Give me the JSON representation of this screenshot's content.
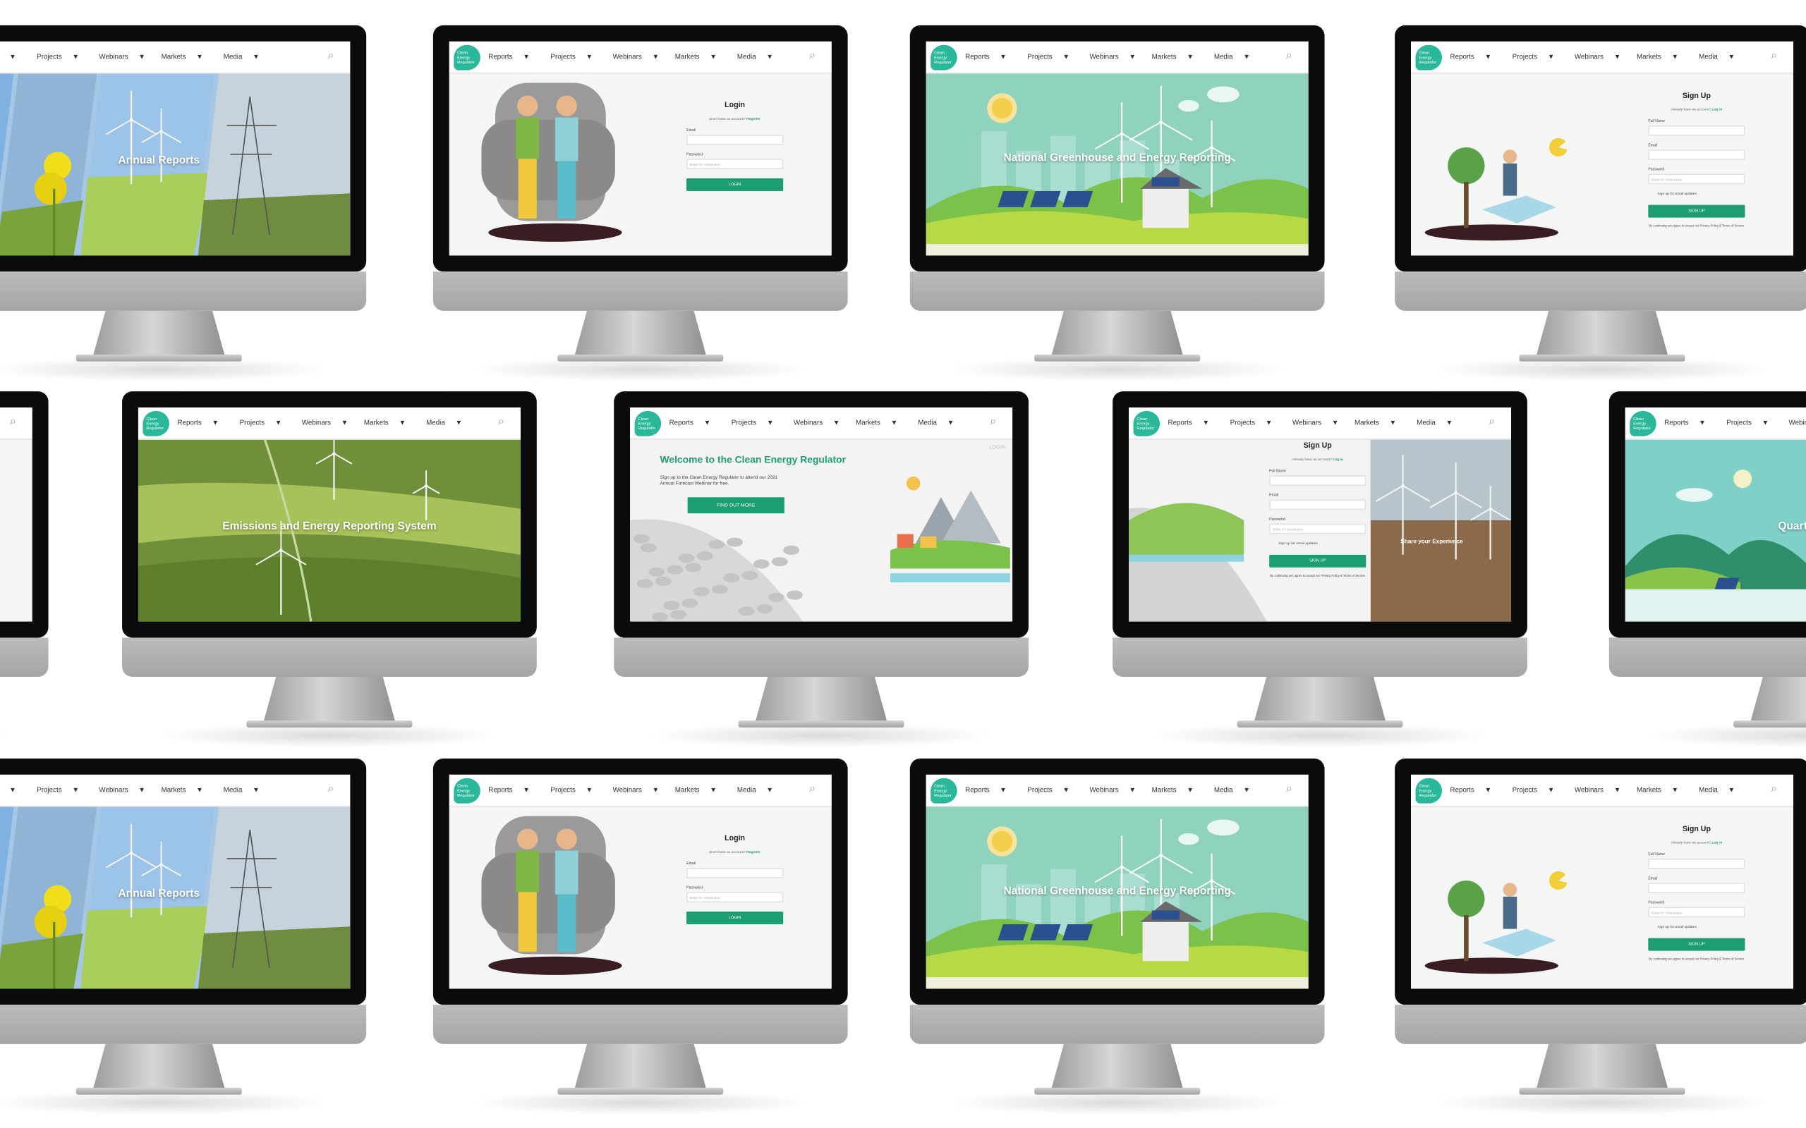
{
  "nav": {
    "logo_text": "Clean Energy Regulator",
    "items": [
      "Reports",
      "Projects",
      "Webinars",
      "Markets",
      "Media"
    ],
    "caret": "▼",
    "search_icon": "search-icon"
  },
  "apple_glyph": "",
  "screens": {
    "annual": {
      "title": "Annual Reports"
    },
    "greenhouse": {
      "title": "National Greenhouse and Energy Reporting"
    },
    "emissions": {
      "title": "Emissions and Energy Reporting System"
    },
    "quarterly": {
      "title": "Quarterly Carb"
    },
    "login": {
      "title": "Login",
      "subtitle": "Don't have an account?",
      "register_link": "Register",
      "email_label": "Email",
      "password_label": "Password",
      "password_placeholder": "Enter 8+ characters",
      "button": "LOGIN"
    },
    "signup": {
      "title": "Sign Up",
      "subtitle": "Already have an account?",
      "login_link": "Log in",
      "fullname_label": "Full Name",
      "email_label": "Email",
      "password_label": "Password",
      "password_placeholder": "Enter 8+ characters",
      "checkbox_label": "Sign up for email updates",
      "button": "SIGN UP",
      "note": "By continuing you agree to accept our Privacy Policy & Terms of Service"
    },
    "welcome": {
      "title": "Welcome to the Clean Energy Regulator",
      "body": "Sign up to the Clean Energy Regulator to attend our 2021 Annual Forecast Webinar for free.",
      "button": "FIND OUT MORE",
      "login_link": "LOGIN"
    },
    "share": {
      "title": "Share your Experience"
    }
  },
  "colors": {
    "accent": "#1d9e70",
    "teal": "#8fd3bf",
    "bezel": "#0b0b0b",
    "aluminium": "#b0b2b4"
  }
}
